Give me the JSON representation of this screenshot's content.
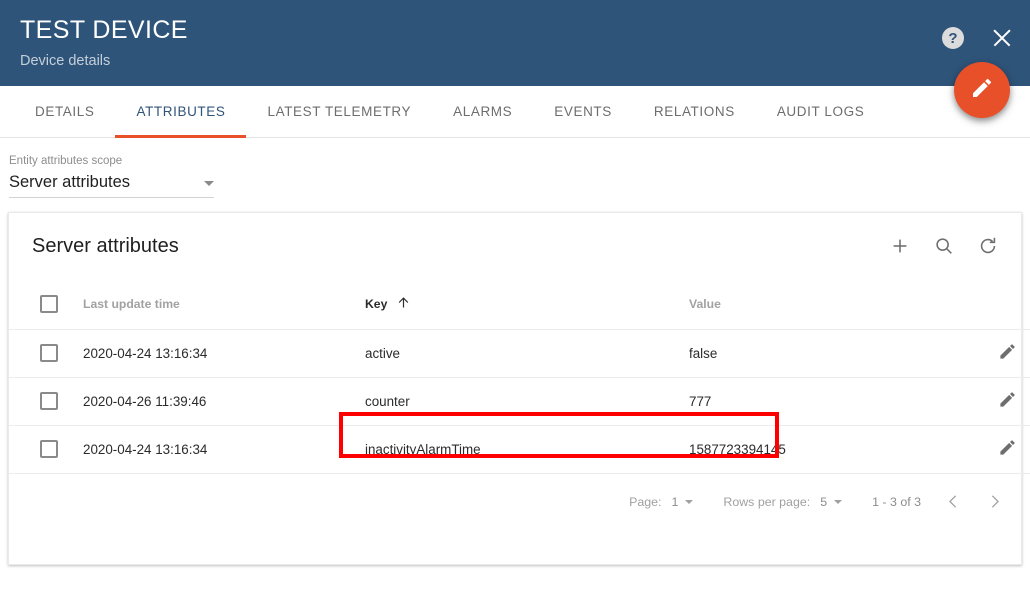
{
  "header": {
    "title": "TEST DEVICE",
    "subtitle": "Device details",
    "help_icon": "help-icon",
    "close_icon": "close-icon",
    "edit_fab_icon": "pencil-icon",
    "bg_color": "#2f5479",
    "accent_color": "#e8502a"
  },
  "tabs": [
    {
      "label": "DETAILS",
      "active": false
    },
    {
      "label": "ATTRIBUTES",
      "active": true
    },
    {
      "label": "LATEST TELEMETRY",
      "active": false
    },
    {
      "label": "ALARMS",
      "active": false
    },
    {
      "label": "EVENTS",
      "active": false
    },
    {
      "label": "RELATIONS",
      "active": false
    },
    {
      "label": "AUDIT LOGS",
      "active": false
    }
  ],
  "scope": {
    "label": "Entity attributes scope",
    "value": "Server attributes"
  },
  "card": {
    "title": "Server attributes",
    "tools": [
      {
        "name": "add-icon",
        "label": "+"
      },
      {
        "name": "search-icon",
        "label": "search"
      },
      {
        "name": "refresh-icon",
        "label": "refresh"
      }
    ]
  },
  "table": {
    "columns": [
      {
        "key": "time",
        "label": "Last update time",
        "sorted": false
      },
      {
        "key": "key",
        "label": "Key",
        "sorted": true,
        "sort_dir": "asc"
      },
      {
        "key": "value",
        "label": "Value",
        "sorted": false
      }
    ],
    "rows": [
      {
        "time": "2020-04-24 13:16:34",
        "key": "active",
        "value": "false"
      },
      {
        "time": "2020-04-26 11:39:46",
        "key": "counter",
        "value": "777"
      },
      {
        "time": "2020-04-24 13:16:34",
        "key": "inactivityAlarmTime",
        "value": "1587723394145"
      }
    ]
  },
  "annotation": {
    "color": "#ff0000",
    "target_row_key": "counter"
  },
  "paginator": {
    "page_label": "Page:",
    "page_value": "1",
    "rows_per_page_label": "Rows per page:",
    "rows_per_page_value": "5",
    "range_label": "1 - 3 of 3",
    "prev_icon": "chevron-left-icon",
    "next_icon": "chevron-right-icon"
  }
}
